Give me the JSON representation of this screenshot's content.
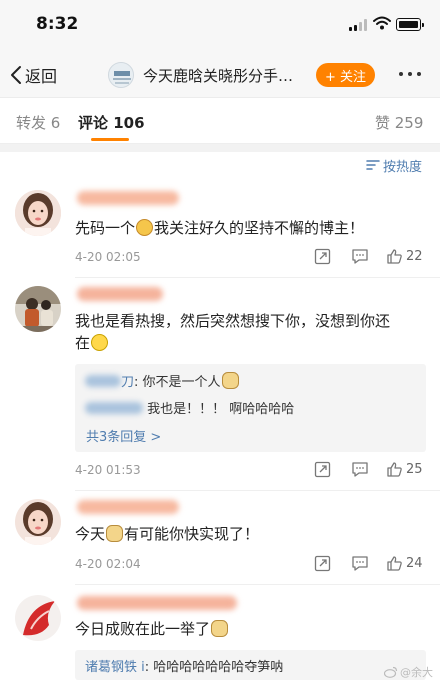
{
  "status_bar": {
    "time": "8:32"
  },
  "nav": {
    "back_label": "返回",
    "title": "今天鹿晗关晓彤分手…",
    "follow_label": "+ 关注"
  },
  "tabs": {
    "repost": "转发 6",
    "comments": "评论 106",
    "likes": "赞 259"
  },
  "sort_label": "按热度",
  "comments": [
    {
      "text_a": "先码一个",
      "text_b": "我关注好久的坚持不懈的博主！",
      "time": "4-20 02:05",
      "likes": "22"
    },
    {
      "text_line1": "我也是看热搜，然后突然想搜下你，没想到你还",
      "text_line2": "在",
      "time": "4-20 01:53",
      "likes": "25",
      "replies": [
        {
          "name_suffix": "刀",
          "text": ": 你不是一个人"
        },
        {
          "name_suffix": "",
          "text": "我也是！！！ 啊哈哈哈哈"
        }
      ],
      "more_replies": "共3条回复 >"
    },
    {
      "text_a": "今天",
      "text_b": "有可能你快实现了！",
      "time": "4-20 02:04",
      "likes": "24"
    },
    {
      "text_a": "今日成败在此一举了",
      "reply_name": "诸葛钢铁 i",
      "reply_text": ": 哈哈哈哈哈哈哈夺笋呐"
    }
  ],
  "watermark": "@余大",
  "colors": {
    "accent": "#ff8200",
    "link": "#507daf"
  }
}
